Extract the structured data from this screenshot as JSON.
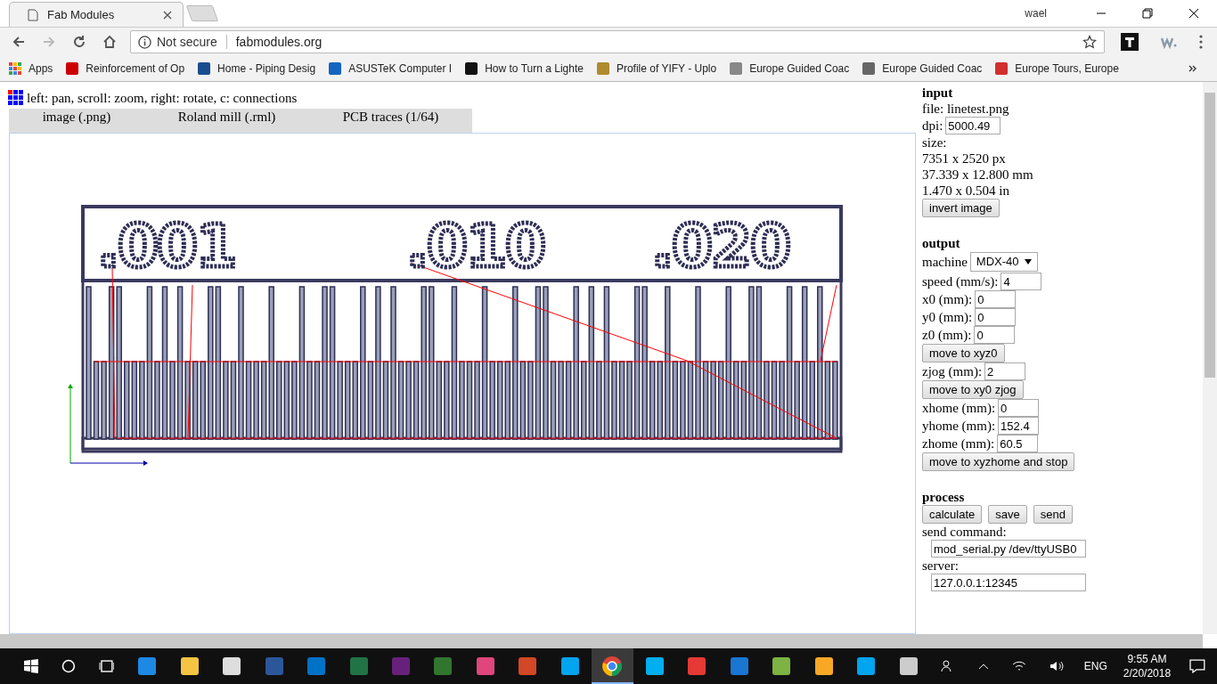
{
  "browser": {
    "tabs": [
      {
        "title": "Fab Modules",
        "selected": true
      }
    ],
    "user": "wael",
    "security": "Not secure",
    "url": "fabmodules.org",
    "bookmarks": [
      "Apps",
      "Reinforcement of Op",
      "Home - Piping Desig",
      "ASUSTeK Computer I",
      "How to Turn a Lighte",
      "Profile of YIFY - Uplo",
      "Europe Guided Coac",
      "Europe Guided Coac",
      "Europe Tours, Europe"
    ]
  },
  "page": {
    "hint": "left: pan, scroll: zoom, right: rotate, c: connections",
    "steps": [
      "image (.png)",
      "Roland mill (.rml)",
      "PCB traces (1/64)"
    ],
    "canvas_labels": [
      ".001",
      ".010",
      ".020"
    ],
    "input": {
      "heading": "input",
      "file": "file: linetest.png",
      "dpi_label": "dpi:",
      "dpi": "5000.49",
      "size_label": "size:",
      "sizes": [
        "7351 x 2520 px",
        "37.339 x 12.800 mm",
        "1.470 x 0.504 in"
      ],
      "invert": "invert image"
    },
    "output": {
      "heading": "output",
      "machine_label": "machine",
      "machine": "MDX-40",
      "rows": [
        {
          "kind": "field",
          "label": "speed (mm/s):",
          "value": "4"
        },
        {
          "kind": "field",
          "label": "x0 (mm):",
          "value": "0"
        },
        {
          "kind": "field",
          "label": "y0 (mm):",
          "value": "0"
        },
        {
          "kind": "field",
          "label": "z0 (mm):",
          "value": "0"
        },
        {
          "kind": "button",
          "label": "move to xyz0"
        },
        {
          "kind": "field",
          "label": "zjog (mm):",
          "value": "2"
        },
        {
          "kind": "button",
          "label": "move to xy0 zjog"
        },
        {
          "kind": "field",
          "label": "xhome (mm):",
          "value": "0"
        },
        {
          "kind": "field",
          "label": "yhome (mm):",
          "value": "152.4"
        },
        {
          "kind": "field",
          "label": "zhome (mm):",
          "value": "60.5"
        },
        {
          "kind": "button",
          "label": "move to xyzhome and stop"
        }
      ]
    },
    "process": {
      "heading": "process",
      "buttons": [
        "calculate",
        "save",
        "send"
      ],
      "command_label": "send command:",
      "command": "mod_serial.py /dev/ttyUSB0",
      "server_label": "server:",
      "server": "127.0.0.1:12345"
    }
  },
  "taskbar": {
    "apps": [
      {
        "selected": false
      },
      {
        "selected": false
      },
      {
        "selected": false
      },
      {
        "selected": false
      },
      {
        "selected": false
      },
      {
        "selected": false
      },
      {
        "selected": false
      },
      {
        "selected": false
      },
      {
        "selected": false
      },
      {
        "selected": false
      },
      {
        "selected": false
      },
      {
        "selected": true
      },
      {
        "selected": false
      },
      {
        "selected": false
      },
      {
        "selected": false
      },
      {
        "selected": false
      },
      {
        "selected": false
      },
      {
        "selected": false
      },
      {
        "selected": false
      }
    ],
    "language": "ENG",
    "time": "9:55 AM",
    "date": "2/20/2018"
  }
}
